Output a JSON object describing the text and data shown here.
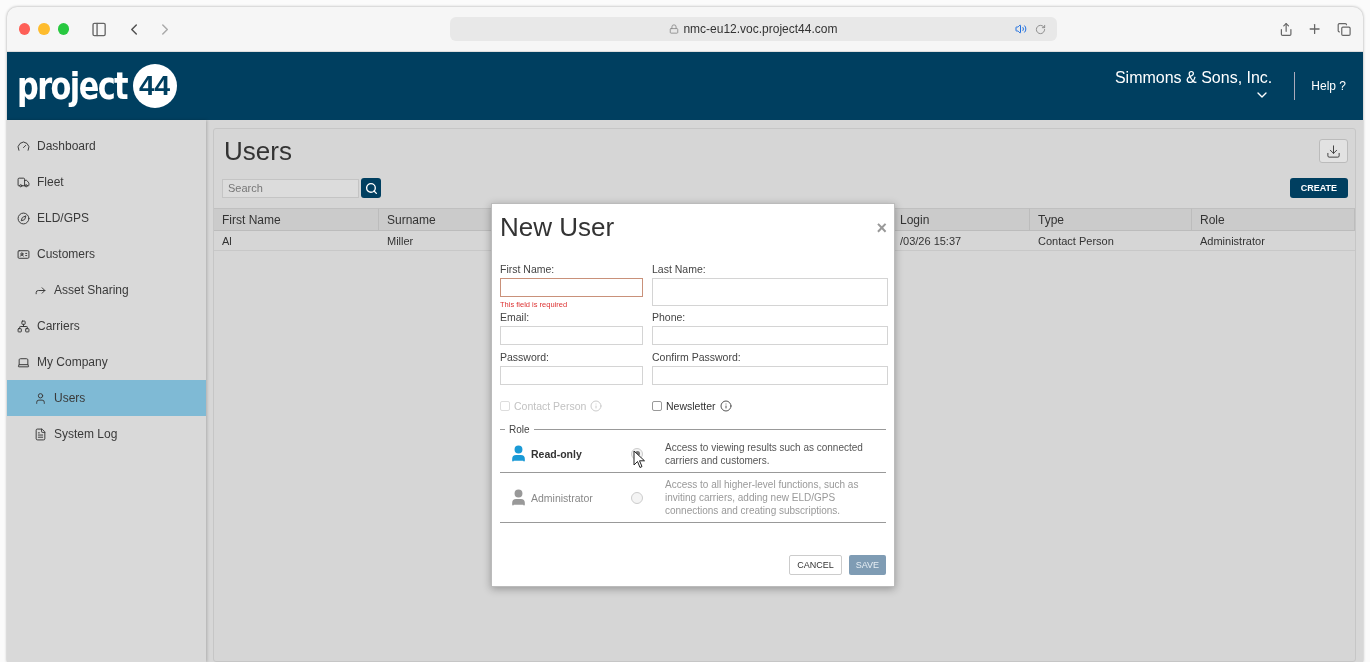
{
  "browser": {
    "url": "nmc-eu12.voc.project44.com"
  },
  "header": {
    "logo_text": "project",
    "logo_badge": "44",
    "company": "Simmons & Sons, Inc.",
    "help": "Help ?"
  },
  "sidebar": {
    "items": [
      {
        "label": "Dashboard",
        "selected": false
      },
      {
        "label": "Fleet",
        "selected": false
      },
      {
        "label": "ELD/GPS",
        "selected": false
      },
      {
        "label": "Customers",
        "selected": false,
        "children": [
          {
            "label": "Asset Sharing",
            "selected": false
          }
        ]
      },
      {
        "label": "Carriers",
        "selected": false
      },
      {
        "label": "My Company",
        "selected": false,
        "children": [
          {
            "label": "Users",
            "selected": true
          },
          {
            "label": "System Log",
            "selected": false
          }
        ]
      }
    ]
  },
  "page": {
    "title": "Users",
    "search": {
      "placeholder": "Search"
    },
    "create": "CREATE"
  },
  "table": {
    "columns": [
      "First Name",
      "Surname",
      "",
      "Login",
      "Type",
      "Role"
    ],
    "rows": [
      [
        "Al",
        "Miller",
        "",
        "/03/26 15:37",
        "Contact Person",
        "Administrator"
      ]
    ]
  },
  "dialog": {
    "title": "New User",
    "close": "×",
    "fields": [
      {
        "label": "First Name:",
        "error": "This field is required"
      },
      {
        "label": "Last Name:"
      },
      {
        "label": "Email:"
      },
      {
        "label": "Phone:"
      },
      {
        "label": "Password:"
      },
      {
        "label": "Confirm Password:"
      }
    ],
    "checkboxes": [
      {
        "label": "Contact Person",
        "checked": false,
        "disabled": true
      },
      {
        "label": "Newsletter",
        "checked": false,
        "disabled": false
      }
    ],
    "role_legend": "Role",
    "roles": [
      {
        "label": "Read-only",
        "description": "Access to viewing results such as connected carriers and customers.",
        "selected": true
      },
      {
        "label": "Administrator",
        "description": "Access to all higher-level functions, such as inviting carriers, adding new ELD/GPS connections and creating subscriptions.",
        "selected": false
      }
    ],
    "buttons": [
      {
        "label": "CANCEL",
        "kind": "secondary",
        "disabled": false
      },
      {
        "label": "SAVE",
        "kind": "primary",
        "disabled": true
      }
    ]
  }
}
